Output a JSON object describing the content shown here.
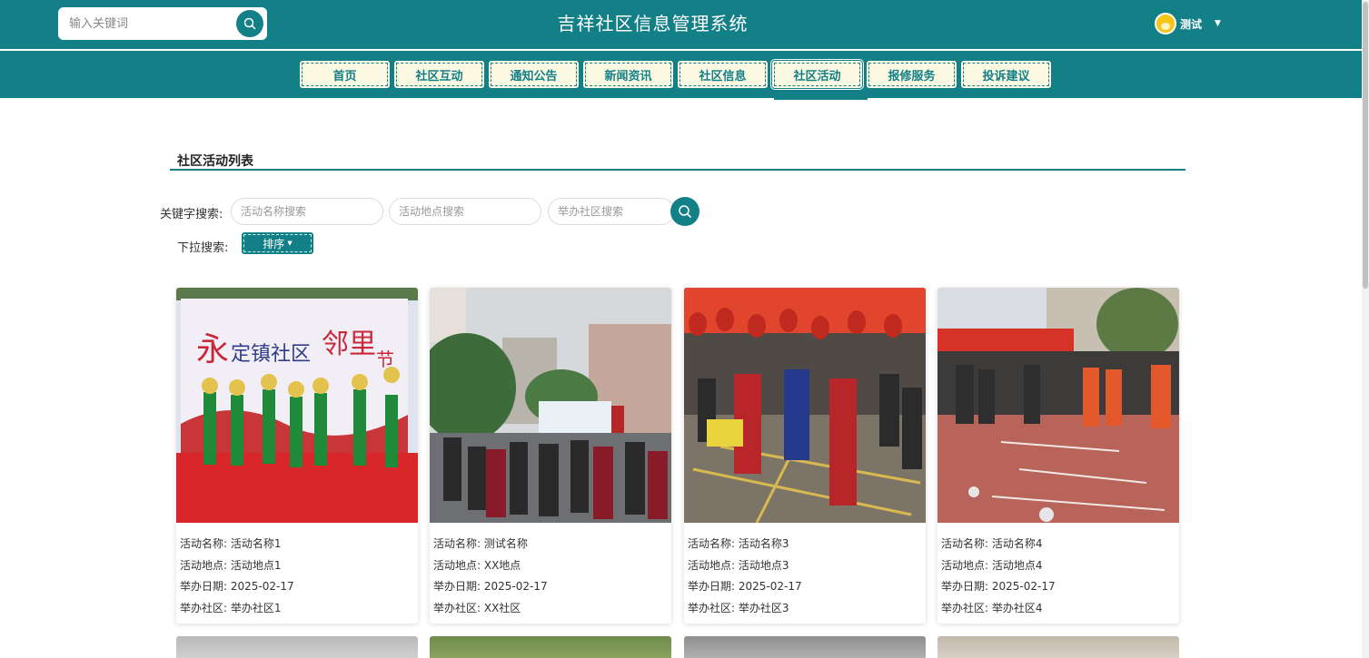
{
  "header": {
    "search_placeholder": "输入关键词",
    "site_title": "吉祥社区信息管理系统",
    "user_name": "测试"
  },
  "nav": {
    "items": [
      "首页",
      "社区互动",
      "通知公告",
      "新闻资讯",
      "社区信息",
      "社区活动",
      "报修服务",
      "投诉建议"
    ],
    "active_item": "社区活动"
  },
  "list": {
    "title": "社区活动列表",
    "keyword_label": "关键字搜索:",
    "name_placeholder": "活动名称搜索",
    "location_placeholder": "活动地点搜索",
    "community_placeholder": "举办社区搜索",
    "dropdown_label": "下拉搜索:",
    "sort_label": "排序"
  },
  "cards": [
    {
      "name": "活动名称: 活动名称1",
      "location": "活动地点: 活动地点1",
      "date": "举办日期: 2025-02-17",
      "community": "举办社区: 举办社区1"
    },
    {
      "name": "活动名称: 测试名称",
      "location": "活动地点: XX地点",
      "date": "举办日期: 2025-02-17",
      "community": "举办社区: XX社区"
    },
    {
      "name": "活动名称: 活动名称3",
      "location": "活动地点: 活动地点3",
      "date": "举办日期: 2025-02-17",
      "community": "举办社区: 举办社区3"
    },
    {
      "name": "活动名称: 活动名称4",
      "location": "活动地点: 活动地点4",
      "date": "举办日期: 2025-02-17",
      "community": "举办社区: 举办社区4"
    }
  ],
  "colors": {
    "primary": "#137f86",
    "nav_bg": "#fcf9e3"
  }
}
